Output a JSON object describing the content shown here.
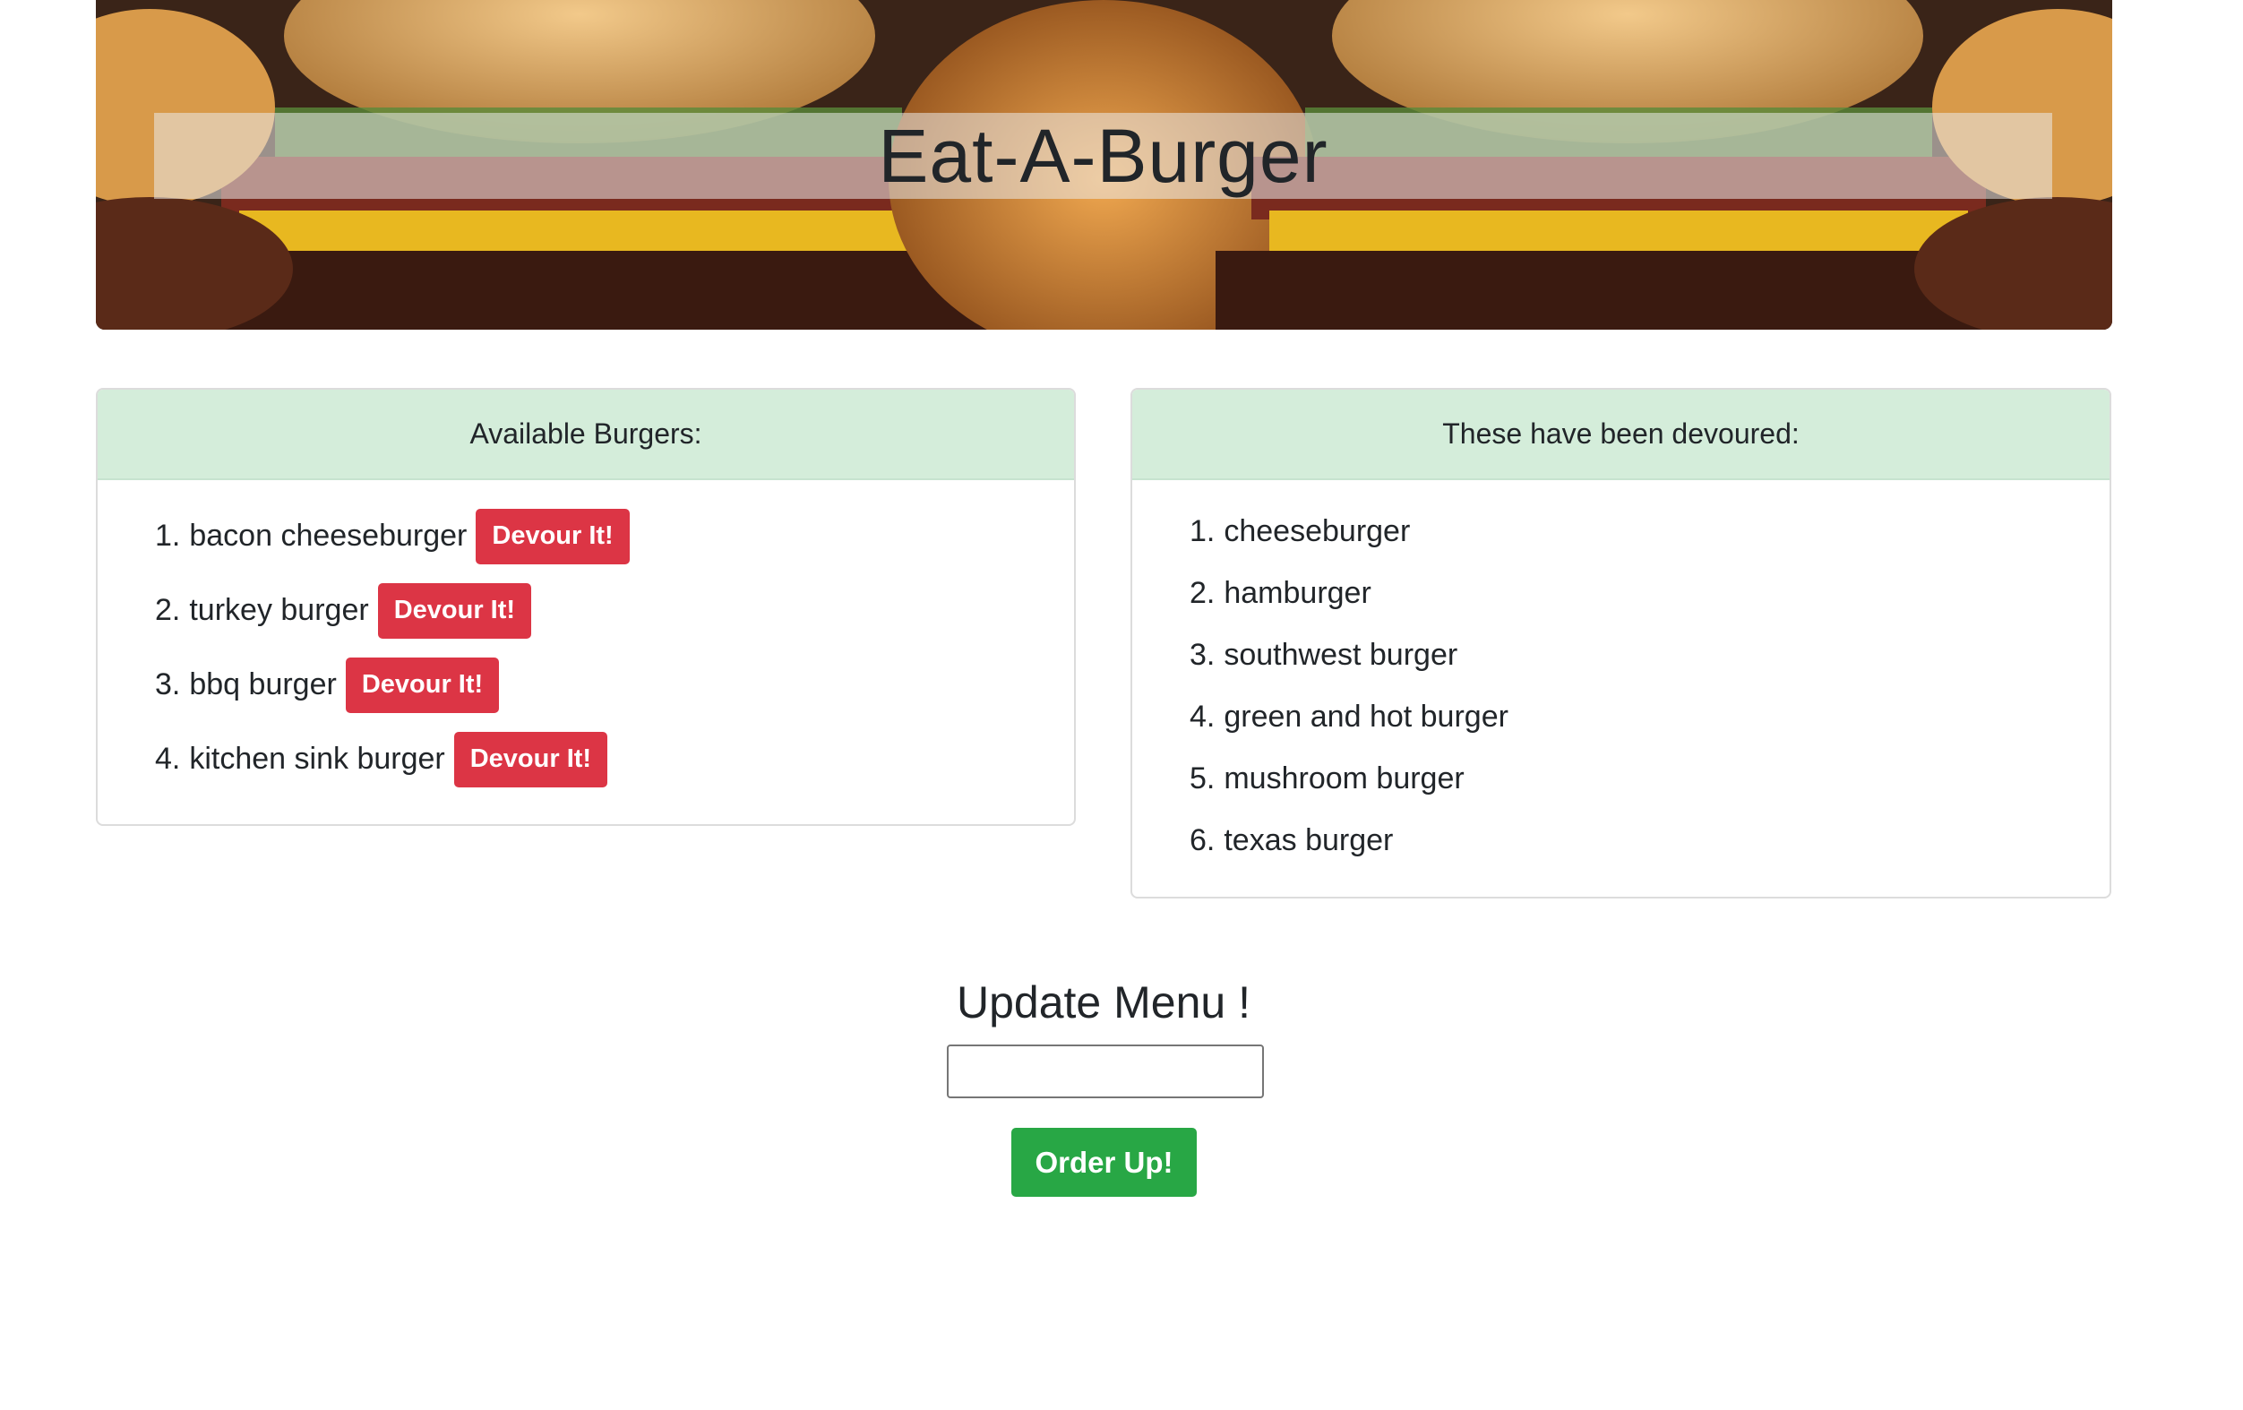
{
  "header": {
    "title": "Eat-A-Burger"
  },
  "available": {
    "heading": "Available Burgers:",
    "items": [
      {
        "num": "1.",
        "name": "bacon cheeseburger",
        "button": "Devour It!"
      },
      {
        "num": "2.",
        "name": "turkey burger",
        "button": "Devour It!"
      },
      {
        "num": "3.",
        "name": "bbq burger",
        "button": "Devour It!"
      },
      {
        "num": "4.",
        "name": "kitchen sink burger",
        "button": "Devour It!"
      }
    ]
  },
  "devoured": {
    "heading": "These have been devoured:",
    "items": [
      {
        "num": "1.",
        "name": "cheeseburger"
      },
      {
        "num": "2.",
        "name": "hamburger"
      },
      {
        "num": "3.",
        "name": "southwest burger"
      },
      {
        "num": "4.",
        "name": "green and hot burger"
      },
      {
        "num": "5.",
        "name": "mushroom burger"
      },
      {
        "num": "6.",
        "name": "texas burger"
      }
    ]
  },
  "form": {
    "title": "Update Menu !",
    "input_value": "",
    "submit_label": "Order Up!"
  },
  "colors": {
    "header_bg": "#d4edda",
    "devour_button": "#dc3545",
    "order_button": "#28a745"
  }
}
